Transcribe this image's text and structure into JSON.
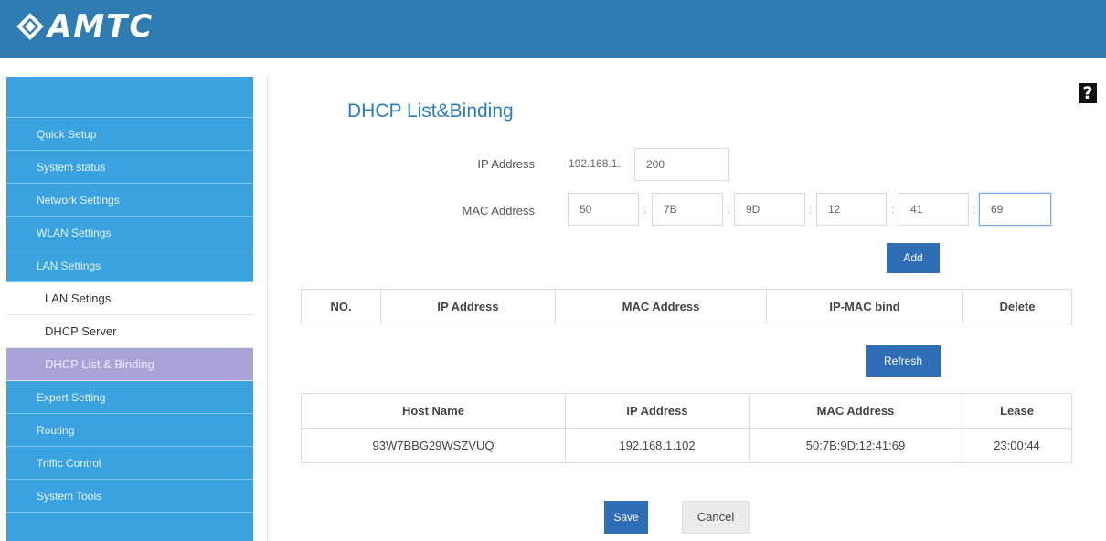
{
  "brand": {
    "logo_text": "AMTC"
  },
  "sidebar": {
    "items": [
      {
        "label": "Quick Setup"
      },
      {
        "label": "System status"
      },
      {
        "label": "Network Settings"
      },
      {
        "label": "WLAN Settings"
      },
      {
        "label": "LAN Settings"
      }
    ],
    "sub_items": [
      {
        "label": "LAN Setings"
      },
      {
        "label": "DHCP Server"
      },
      {
        "label": "DHCP List & Binding"
      }
    ],
    "items_after": [
      {
        "label": "Expert Setting"
      },
      {
        "label": "Routing"
      },
      {
        "label": "Triffic Control"
      },
      {
        "label": "System Tools"
      }
    ]
  },
  "help": {
    "label": "?"
  },
  "page": {
    "title": "DHCP List&Binding"
  },
  "form": {
    "ip_label": "IP Address",
    "ip_prefix": "192.168.1.",
    "ip_last": "200",
    "mac_label": "MAC Address",
    "mac_parts": [
      "50",
      "7B",
      "9D",
      "12",
      "41",
      "69"
    ],
    "separator": ":",
    "add_label": "Add"
  },
  "binding_table": {
    "headers": [
      "NO.",
      "IP Address",
      "MAC Address",
      "IP-MAC bind",
      "Delete"
    ]
  },
  "refresh_label": "Refresh",
  "client_table": {
    "headers": [
      "Host Name",
      "IP Address",
      "MAC Address",
      "Lease"
    ],
    "rows": [
      [
        "93W7BBG29WSZVUQ",
        "192.168.1.102",
        "50:7B:9D:12:41:69",
        "23:00:44"
      ]
    ]
  },
  "actions": {
    "save_label": "Save",
    "cancel_label": "Cancel"
  },
  "colors": {
    "header": "#2f7cb2",
    "sidebar": "#3aa3df",
    "active": "#a9a4d8",
    "accent": "#2f6db6"
  }
}
